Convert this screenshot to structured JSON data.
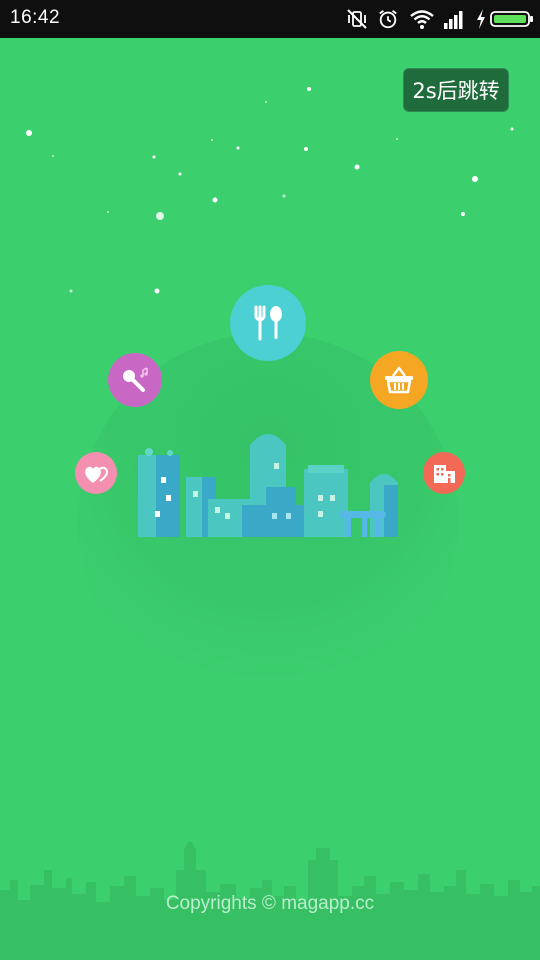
{
  "status_bar": {
    "time": "16:42",
    "icons": [
      "vibrate-off-icon",
      "alarm-icon",
      "wifi-icon",
      "signal-icon",
      "charging-icon",
      "battery-icon"
    ]
  },
  "splash": {
    "skip_label": "2s后跳转",
    "copyright": "Copyrights © magapp.cc",
    "feature_icons": [
      "microphone-icon",
      "fork-spoon-icon",
      "shopping-basket-icon",
      "hotel-icon",
      "heart-icon"
    ]
  },
  "colors": {
    "background": "#3ccf6e",
    "status_bar": "#0f0f0f",
    "skip_button": "#1f6b3c",
    "food": "#4dd0d4",
    "karaoke": "#c868c4",
    "shopping": "#f5a623",
    "hotel": "#f26a55",
    "dating": "#f58fb0"
  }
}
